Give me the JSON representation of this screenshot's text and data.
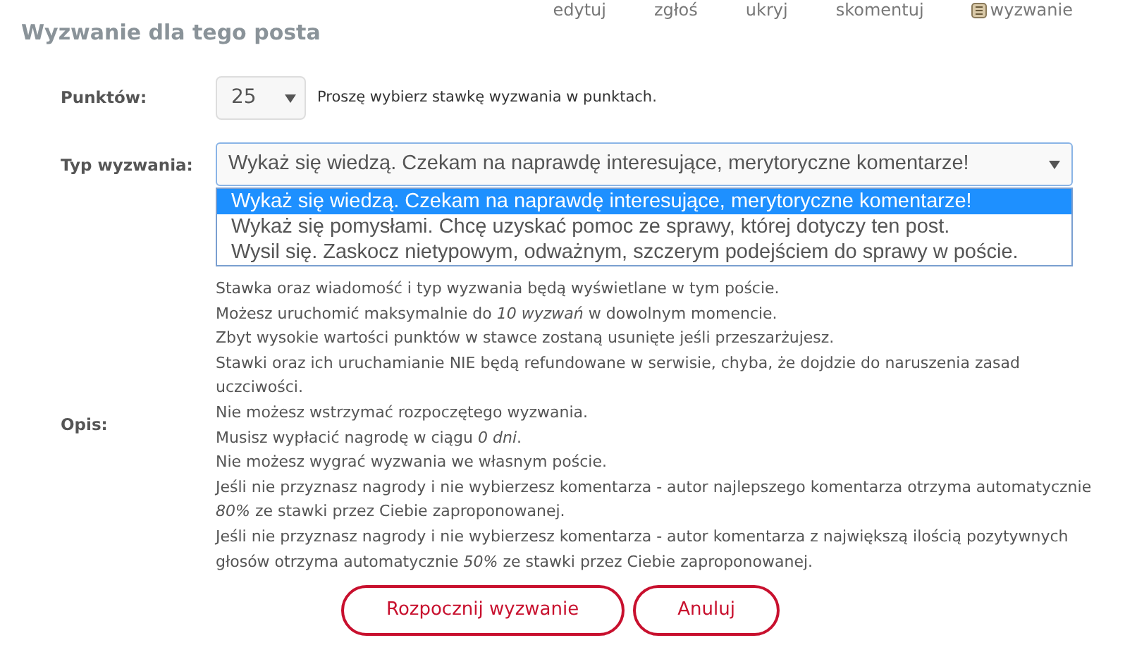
{
  "top_links": [
    {
      "label": "edytuj",
      "kind": "text"
    },
    {
      "label": "zgłoś",
      "kind": "text"
    },
    {
      "label": "ukryj",
      "kind": "text"
    },
    {
      "label": "skomentuj",
      "kind": "text"
    },
    {
      "label": "wyzwanie",
      "kind": "icon"
    }
  ],
  "title": "Wyzwanie dla tego posta",
  "points": {
    "label": "Punktów:",
    "value": "25",
    "hint": "Proszę wybierz stawkę wyzwania w punktach."
  },
  "challenge_type": {
    "label": "Typ wyzwania:",
    "value": "Wykaż się wiedzą. Czekam na naprawdę interesujące, merytoryczne komentarze!",
    "expanded": true,
    "options": [
      {
        "label": "Wykaż się wiedzą. Czekam na naprawdę interesujące, merytoryczne komentarze!",
        "selected": true
      },
      {
        "label": "Wykaż się pomysłami. Chcę uzyskać pomoc ze sprawy, której dotyczy ten post.",
        "selected": false
      },
      {
        "label": "Wysil się. Zaskocz nietypowym, odważnym, szczerym podejściem do sprawy w poście.",
        "selected": false
      }
    ]
  },
  "description": {
    "label": "Opis:",
    "lines": [
      "Stawka oraz wiadomość i typ wyzwania będą wyświetlane w tym poście.",
      "Możesz uruchomić maksymalnie do *10 wyzwań* w dowolnym momencie.",
      "Zbyt wysokie wartości punktów w stawce zostaną usunięte jeśli przeszarżujesz.",
      "Stawki oraz ich uruchamianie NIE będą refundowane w serwisie, chyba, że dojdzie do naruszenia zasad uczciwości.",
      "Nie możesz wstrzymać rozpoczętego wyzwania.",
      "Musisz wypłacić nagrodę w ciągu *0 dni*.",
      "Nie możesz wygrać wyzwania we własnym poście.",
      "Jeśli nie przyznasz nagrody i nie wybierzesz komentarza - autor najlepszego komentarza otrzyma automatycznie *80%* ze stawki przez Ciebie zaproponowanej.",
      "Jeśli nie przyznasz nagrody i nie wybierzesz komentarza - autor komentarza z największą ilością pozytywnych głosów otrzyma automatycznie *50%* ze stawki przez Ciebie zaproponowanej."
    ]
  },
  "buttons": [
    "Rozpocznij wyzwanie",
    "Anuluj"
  ]
}
